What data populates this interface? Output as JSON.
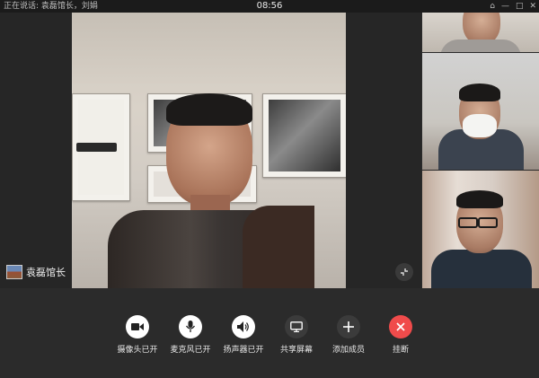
{
  "titlebar": {
    "speaking_label": "正在说话: 袁磊馆长，刘娟",
    "clock": "08:56",
    "window_controls": [
      "pin-icon",
      "minimize-icon",
      "maximize-icon",
      "close-icon"
    ]
  },
  "main_video": {
    "name": "袁磊馆长"
  },
  "controls": [
    {
      "label": "摄像头已开",
      "icon": "camera-icon"
    },
    {
      "label": "麦克风已开",
      "icon": "microphone-icon"
    },
    {
      "label": "扬声器已开",
      "icon": "speaker-icon"
    },
    {
      "label": "共享屏幕",
      "icon": "screen-share-icon"
    },
    {
      "label": "添加成员",
      "icon": "add-icon"
    },
    {
      "label": "挂断",
      "icon": "close-icon"
    }
  ],
  "colors": {
    "hangup": "#f04b4b",
    "control_bg": "#2b2b2b",
    "stage_bg": "#262626"
  }
}
